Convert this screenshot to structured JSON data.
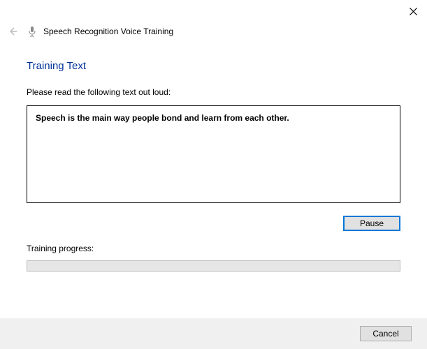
{
  "window": {
    "title": "Speech Recognition Voice Training"
  },
  "section": {
    "heading": "Training Text",
    "instruction": "Please read the following text out loud:",
    "training_sentence": "Speech is the main way people bond and learn from each other.",
    "progress_label": "Training progress:"
  },
  "buttons": {
    "pause": "Pause",
    "cancel": "Cancel"
  }
}
